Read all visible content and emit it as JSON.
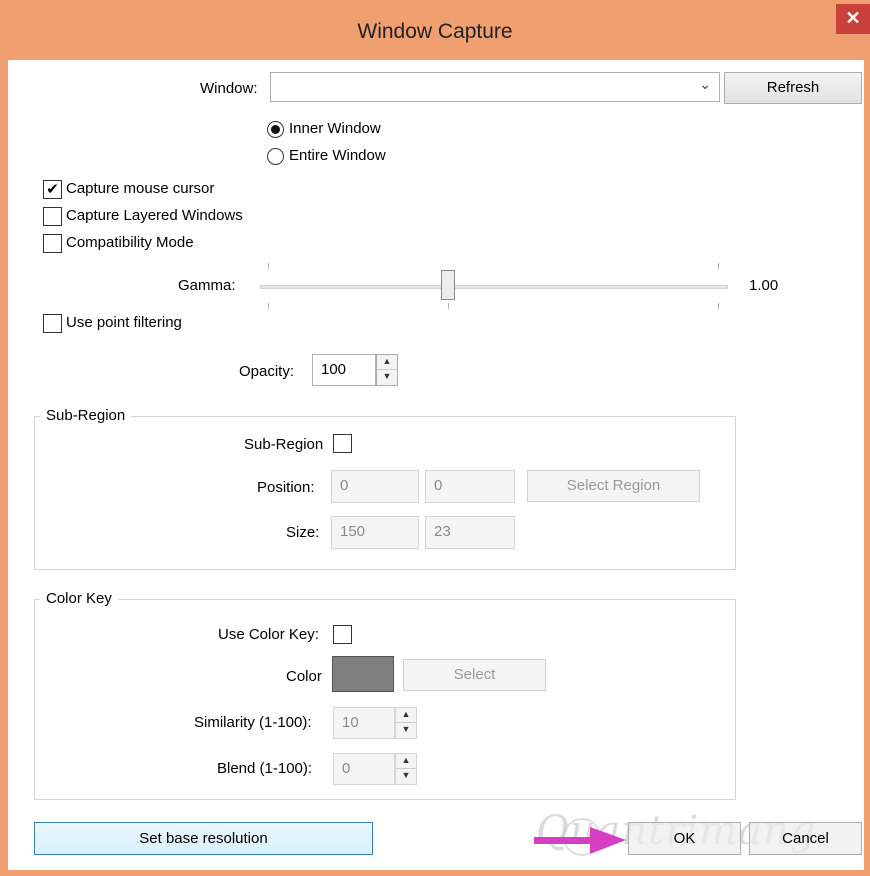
{
  "window": {
    "title": "Window Capture",
    "close_glyph": "✕"
  },
  "source": {
    "window_label": "Window:",
    "window_value": "",
    "refresh_label": "Refresh",
    "capture_mode_options": [
      {
        "label": "Inner Window",
        "selected": true
      },
      {
        "label": "Entire Window",
        "selected": false
      }
    ],
    "capture_mouse_cursor": {
      "label": "Capture mouse cursor",
      "checked": true
    },
    "capture_layered_windows": {
      "label": "Capture Layered Windows",
      "checked": false
    },
    "compatibility_mode": {
      "label": "Compatibility Mode",
      "checked": false
    },
    "gamma": {
      "label": "Gamma:",
      "value_text": "1.00",
      "slider_fraction": 0.4
    },
    "use_point_filtering": {
      "label": "Use point filtering",
      "checked": false
    },
    "opacity": {
      "label": "Opacity:",
      "value": "100"
    }
  },
  "sub_region": {
    "group_title": "Sub-Region",
    "enable_label": "Sub-Region",
    "checked": false,
    "position_label": "Position:",
    "position_x": "0",
    "position_y": "0",
    "select_region_label": "Select Region",
    "size_label": "Size:",
    "size_w": "150",
    "size_h": "23"
  },
  "color_key": {
    "group_title": "Color Key",
    "use_label": "Use Color Key:",
    "checked": false,
    "color_label": "Color",
    "color_swatch": "#7f7f7f",
    "select_label": "Select",
    "similarity_label": "Similarity (1-100):",
    "similarity_value": "10",
    "blend_label": "Blend (1-100):",
    "blend_value": "0"
  },
  "footer": {
    "set_base_resolution_label": "Set base resolution",
    "ok_label": "OK",
    "cancel_label": "Cancel"
  },
  "watermark": {
    "text": "Quantrimang"
  },
  "colors": {
    "titlebar": "#f0a070",
    "close": "#c9413a",
    "arrow": "#d63fc3"
  }
}
